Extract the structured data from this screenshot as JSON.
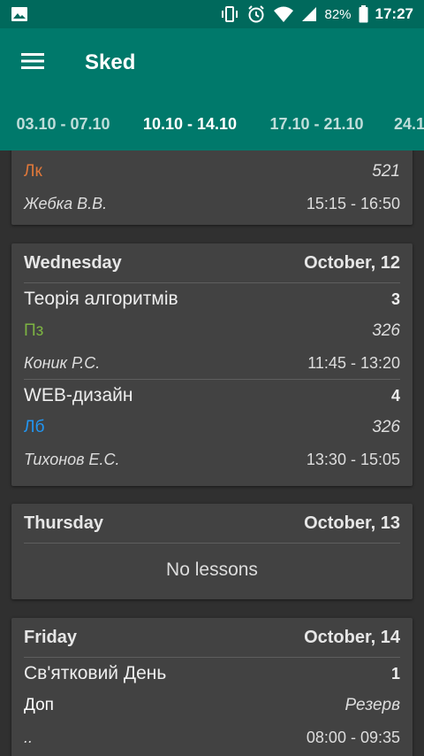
{
  "status_bar": {
    "battery": "82%",
    "time": "17:27",
    "icons": [
      "image-icon",
      "vibrate-icon",
      "alarm-icon",
      "wifi-icon",
      "signal-icon",
      "battery-icon"
    ]
  },
  "app_bar": {
    "title": "Sked",
    "menu_icon": "hamburger-menu-icon"
  },
  "tabs": [
    {
      "label": "03.10 - 07.10",
      "active": false
    },
    {
      "label": "10.10 - 14.10",
      "active": true
    },
    {
      "label": "17.10 - 21.10",
      "active": false
    },
    {
      "label": "24.1",
      "active": false
    }
  ],
  "colors": {
    "primary": "#00796b",
    "status_bar": "#00695c",
    "tab_indicator": "#8bc34a",
    "background": "#303030",
    "card": "#424242",
    "type_lk": "#e0783a",
    "type_pz": "#7cb342",
    "type_lb": "#2196f3"
  },
  "days": [
    {
      "lessons": [
        {
          "type": "Лк",
          "room": "521",
          "teacher": "Жебка В.В.",
          "time": "15:15 - 16:50"
        }
      ]
    },
    {
      "name": "Wednesday",
      "date": "October, 12",
      "lessons": [
        {
          "subject": "Теорія алгоритмів",
          "number": "3",
          "type": "Пз",
          "room": "326",
          "teacher": "Коник Р.С.",
          "time": "11:45 - 13:20"
        },
        {
          "subject": "WEB-дизайн",
          "number": "4",
          "type": "Лб",
          "room": "326",
          "teacher": "Тихонов Е.С.",
          "time": "13:30 - 15:05"
        }
      ]
    },
    {
      "name": "Thursday",
      "date": "October, 13",
      "empty_text": "No lessons"
    },
    {
      "name": "Friday",
      "date": "October, 14",
      "lessons": [
        {
          "subject": "Св'ятковий День",
          "number": "1",
          "type": "Доп",
          "room": "Резерв",
          "teacher": "..",
          "time": "08:00 - 09:35"
        }
      ]
    }
  ]
}
